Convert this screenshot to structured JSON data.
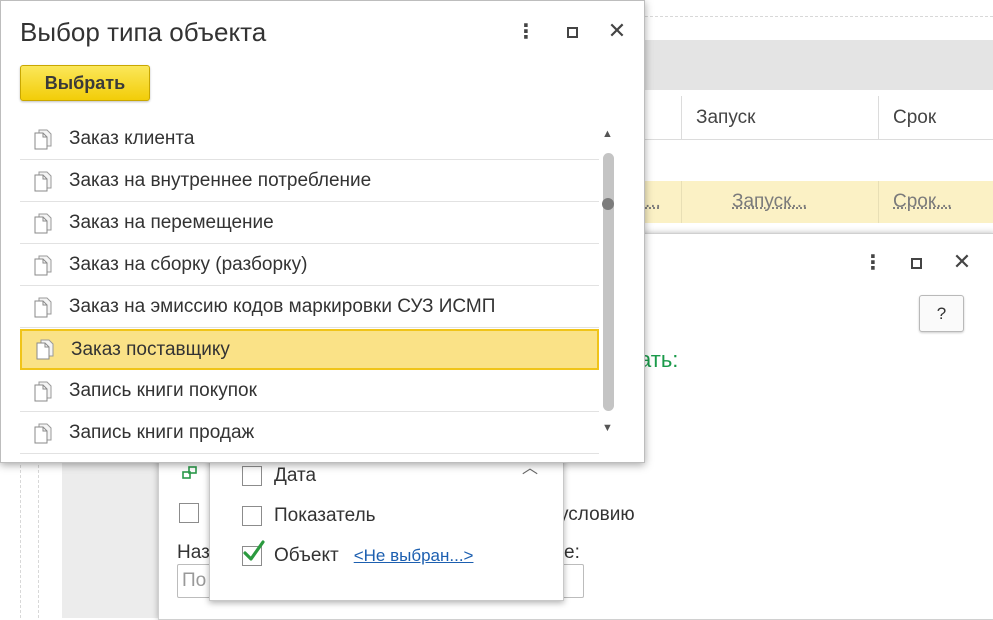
{
  "background": {
    "columns": [
      "Запуск",
      "Срок"
    ],
    "row_links": [
      "...",
      "Запуск...",
      "Срок..."
    ]
  },
  "inner_dialog": {
    "green_text": "ать:",
    "help_label": "?",
    "condition_text": "условию",
    "name_label": "Наз",
    "name_input_placeholder": "По",
    "right_label": "е:"
  },
  "dropdown": {
    "items": [
      {
        "label": "Дата",
        "checked": false
      },
      {
        "label": "Показатель",
        "checked": false
      },
      {
        "label": "Объект",
        "checked": true,
        "link": "<Не выбран...>"
      }
    ]
  },
  "dialog": {
    "title": "Выбор типа объекта",
    "choose_button": "Выбрать",
    "items": [
      {
        "label": "Заказ клиента",
        "selected": false
      },
      {
        "label": "Заказ на внутреннее потребление",
        "selected": false
      },
      {
        "label": "Заказ на перемещение",
        "selected": false
      },
      {
        "label": "Заказ на сборку (разборку)",
        "selected": false
      },
      {
        "label": "Заказ на эмиссию кодов маркировки СУЗ ИСМП",
        "selected": false
      },
      {
        "label": "Заказ поставщику",
        "selected": true
      },
      {
        "label": "Запись книги покупок",
        "selected": false
      },
      {
        "label": "Запись книги продаж",
        "selected": false
      }
    ]
  },
  "colors": {
    "accent_yellow": "#f2cd08",
    "selected_row": "#fae287",
    "link_blue": "#1c5fb0",
    "green_text": "#1a9a4a"
  },
  "icons": [
    "more-vertical-icon",
    "maximize-icon",
    "close-icon",
    "document-icon",
    "checkmark-icon",
    "chevron-up-icon",
    "scroll-up-icon",
    "scroll-down-icon",
    "help-icon"
  ]
}
